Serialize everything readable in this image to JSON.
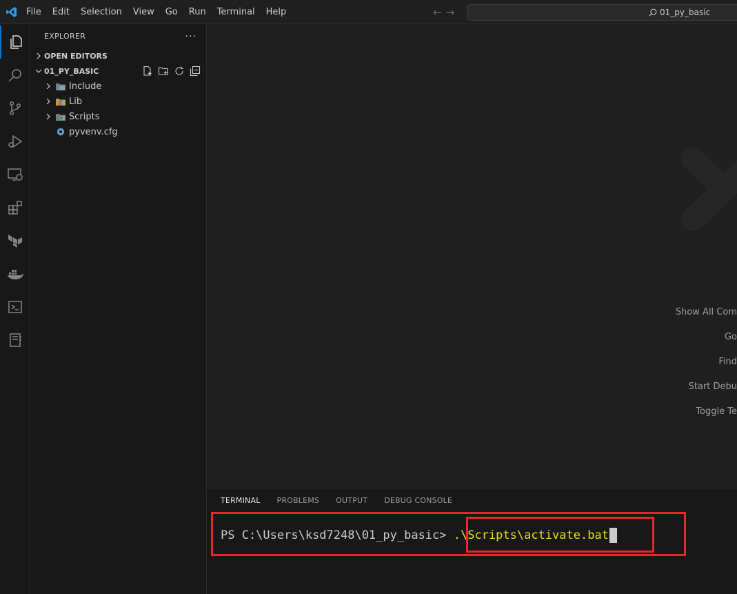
{
  "menu": [
    "File",
    "Edit",
    "Selection",
    "View",
    "Go",
    "Run",
    "Terminal",
    "Help"
  ],
  "search": {
    "text": "01_py_basic"
  },
  "sidebar": {
    "title": "EXPLORER",
    "more": "···",
    "open_editors": "OPEN EDITORS",
    "folder": "01_PY_BASIC",
    "items": [
      {
        "label": "Include",
        "icon": "folder-include-icon",
        "expandable": true
      },
      {
        "label": "Lib",
        "icon": "folder-lib-icon",
        "expandable": true
      },
      {
        "label": "Scripts",
        "icon": "folder-scripts-icon",
        "expandable": true
      },
      {
        "label": "pyvenv.cfg",
        "icon": "gear-icon",
        "expandable": false
      }
    ]
  },
  "editor": {
    "hints": [
      "Show All Com",
      "Go",
      "Find",
      "Start Debu",
      "Toggle Te"
    ]
  },
  "panel": {
    "tabs": [
      "TERMINAL",
      "PROBLEMS",
      "OUTPUT",
      "DEBUG CONSOLE"
    ],
    "active_tab": "TERMINAL"
  },
  "terminal": {
    "prompt": "PS C:\\Users\\ksd7248\\01_py_basic> ",
    "command": ".\\Scripts\\activate.bat"
  },
  "colors": {
    "accent": "#0078d4",
    "highlight": "#e8262c",
    "command": "#e5e510"
  }
}
